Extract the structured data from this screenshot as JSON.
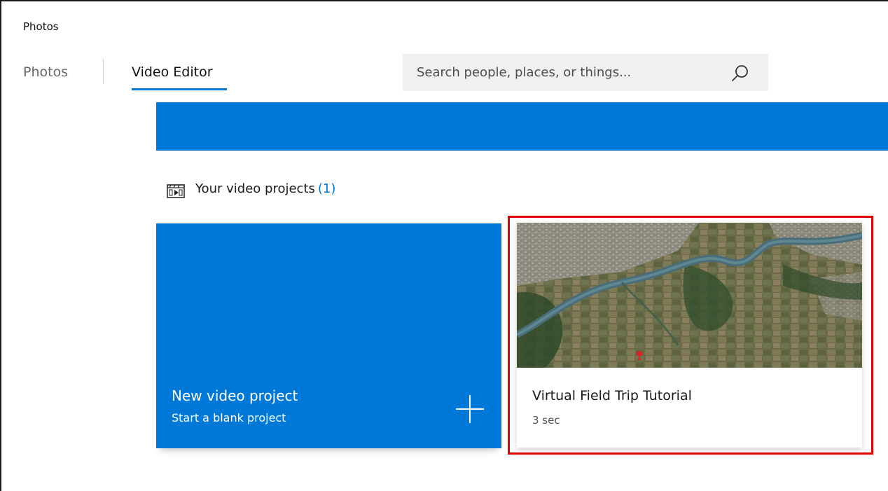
{
  "app": {
    "title": "Photos"
  },
  "tabs": [
    {
      "label": "Photos",
      "selected": false
    },
    {
      "label": "Video Editor",
      "selected": true
    }
  ],
  "search": {
    "placeholder": "Search people, places, or things...",
    "icon": "search-icon"
  },
  "section": {
    "icon": "video-project-icon",
    "title": "Your video projects",
    "count": "(1)"
  },
  "new_project": {
    "title": "New video project",
    "subtitle": "Start a blank project",
    "icon": "plus-icon"
  },
  "projects": [
    {
      "title": "Virtual Field Trip Tutorial",
      "duration": "3 sec",
      "thumbnail": "satellite-map-thumbnail"
    }
  ],
  "colors": {
    "accent": "#0078d7",
    "highlight": "#e00000",
    "search_bg": "#f0f0f0"
  }
}
